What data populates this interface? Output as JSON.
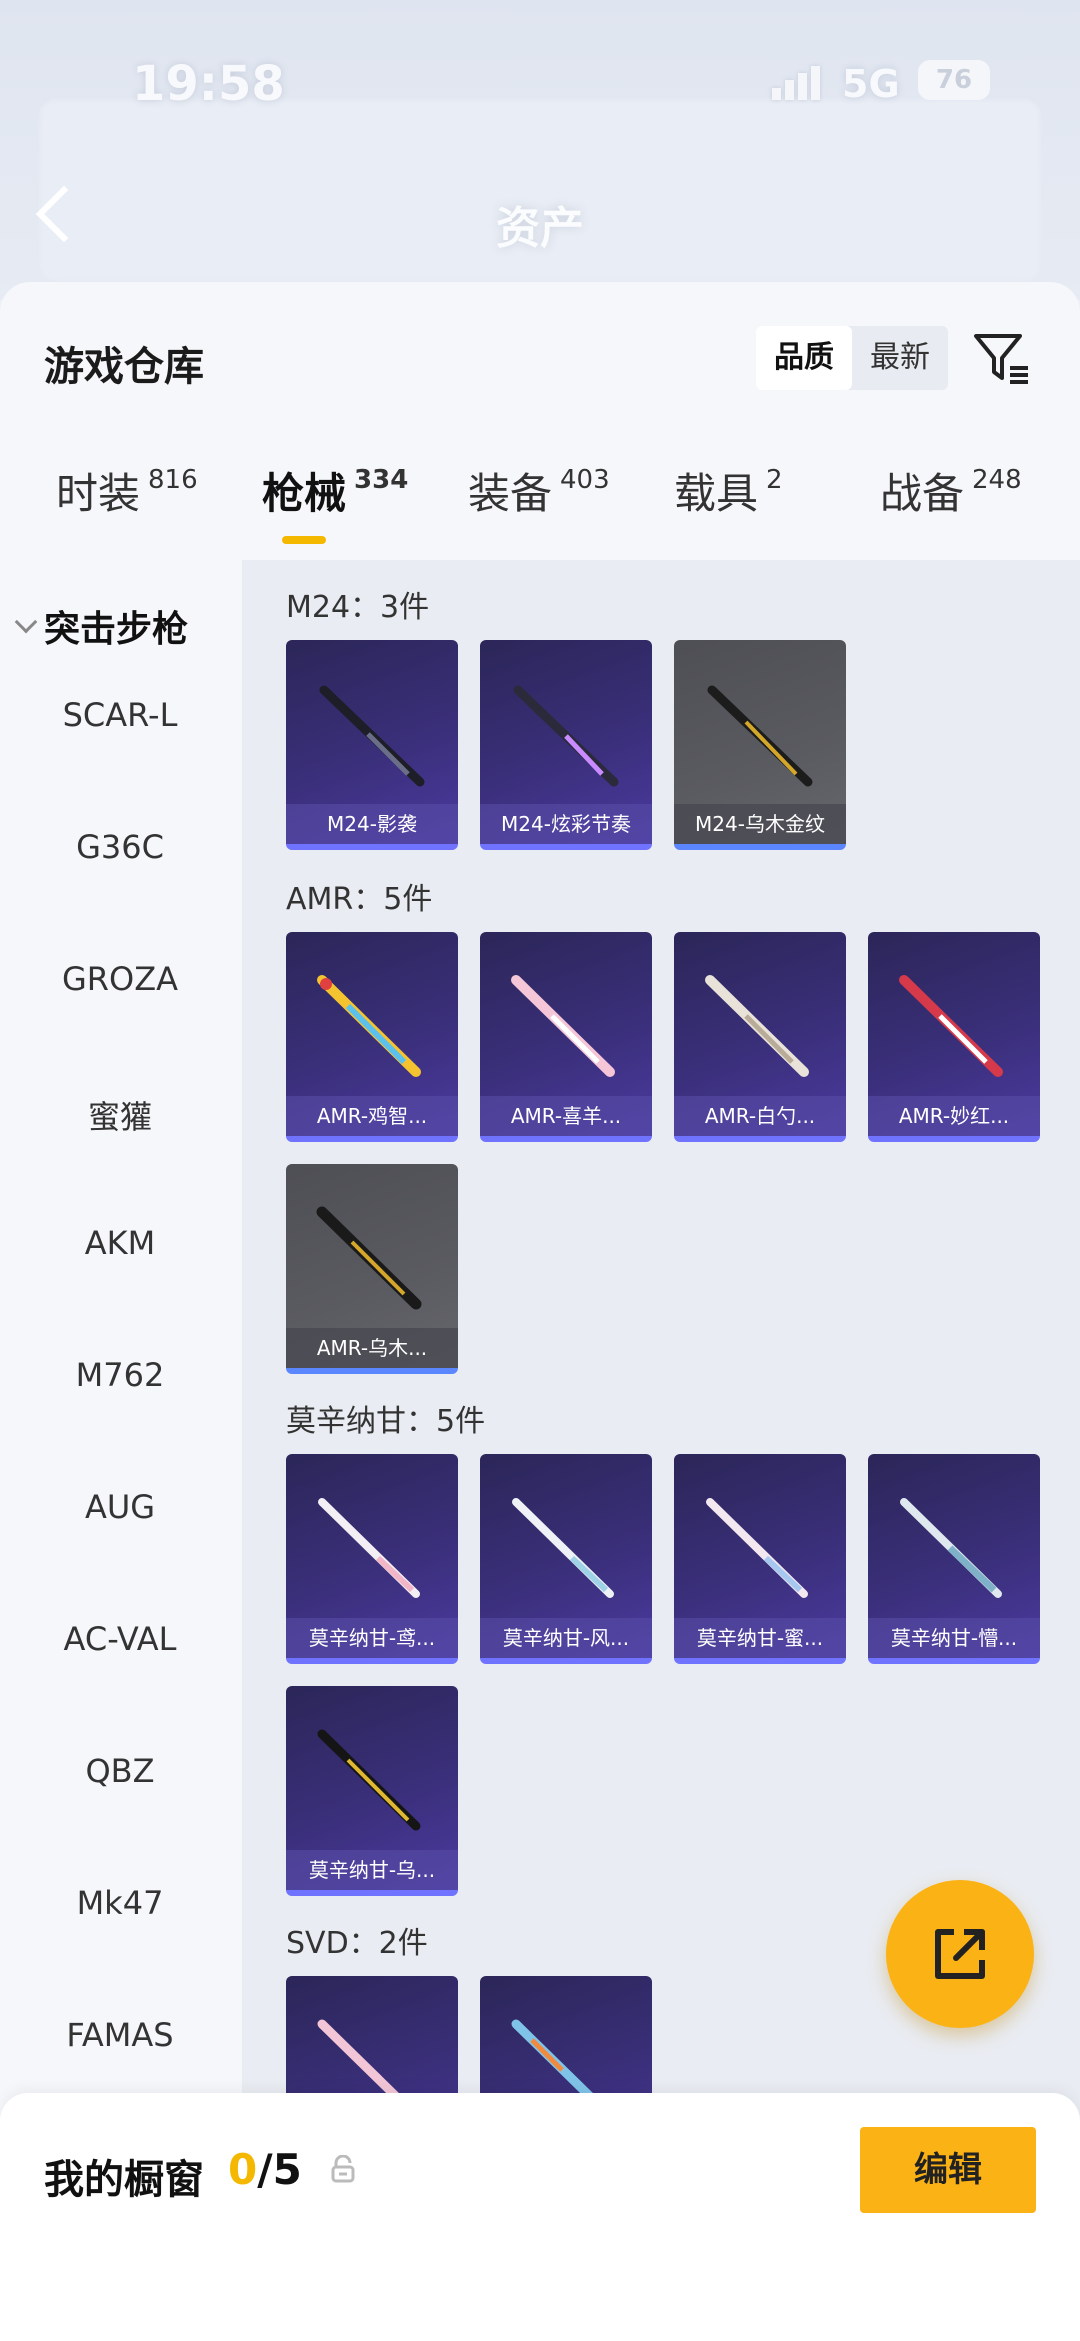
{
  "status": {
    "time": "19:58",
    "network": "5G",
    "battery": "76"
  },
  "header": {
    "title": "资产"
  },
  "sheet": {
    "title": "游戏仓库",
    "sort": {
      "quality": "品质",
      "newest": "最新"
    }
  },
  "tabs": [
    {
      "label": "时装",
      "count": "816"
    },
    {
      "label": "枪械",
      "count": "334"
    },
    {
      "label": "装备",
      "count": "403"
    },
    {
      "label": "载具",
      "count": "2"
    },
    {
      "label": "战备",
      "count": "248"
    }
  ],
  "categories": {
    "group": "突击步枪",
    "items": [
      "SCAR-L",
      "G36C",
      "GROZA",
      "蜜獾",
      "AKM",
      "M762",
      "AUG",
      "AC-VAL",
      "QBZ",
      "Mk47",
      "FAMAS"
    ]
  },
  "sections": [
    {
      "label": "M24：3件",
      "cards": [
        {
          "name": "M24-影袭",
          "style": "purple"
        },
        {
          "name": "M24-炫彩节奏",
          "style": "purple"
        },
        {
          "name": "M24-乌木金纹",
          "style": "gray"
        }
      ]
    },
    {
      "label": "AMR：5件",
      "cards": [
        {
          "name": "AMR-鸡智...",
          "style": "purple"
        },
        {
          "name": "AMR-喜羊...",
          "style": "purple"
        },
        {
          "name": "AMR-白勺...",
          "style": "purple"
        },
        {
          "name": "AMR-妙红...",
          "style": "purple"
        },
        {
          "name": "AMR-乌木...",
          "style": "gray"
        }
      ]
    },
    {
      "label": "莫辛纳甘：5件",
      "cards": [
        {
          "name": "莫辛纳甘-鸢...",
          "style": "purple"
        },
        {
          "name": "莫辛纳甘-风...",
          "style": "purple"
        },
        {
          "name": "莫辛纳甘-蜜...",
          "style": "purple"
        },
        {
          "name": "莫辛纳甘-懵...",
          "style": "purple"
        },
        {
          "name": "莫辛纳甘-乌...",
          "style": "purple"
        }
      ]
    },
    {
      "label": "SVD：2件",
      "cards": [
        {
          "name": "",
          "style": "purple"
        },
        {
          "name": "",
          "style": "purple"
        }
      ]
    }
  ],
  "bottom": {
    "showcase_label": "我的橱窗",
    "showcase_current": "0",
    "showcase_total": "/5",
    "edit_label": "编辑"
  },
  "colors": {
    "accent": "#fbb214",
    "card_purple": "#3a2f7a",
    "card_gray": "#5a5b61",
    "rarity_bar": "#6f73ff"
  }
}
